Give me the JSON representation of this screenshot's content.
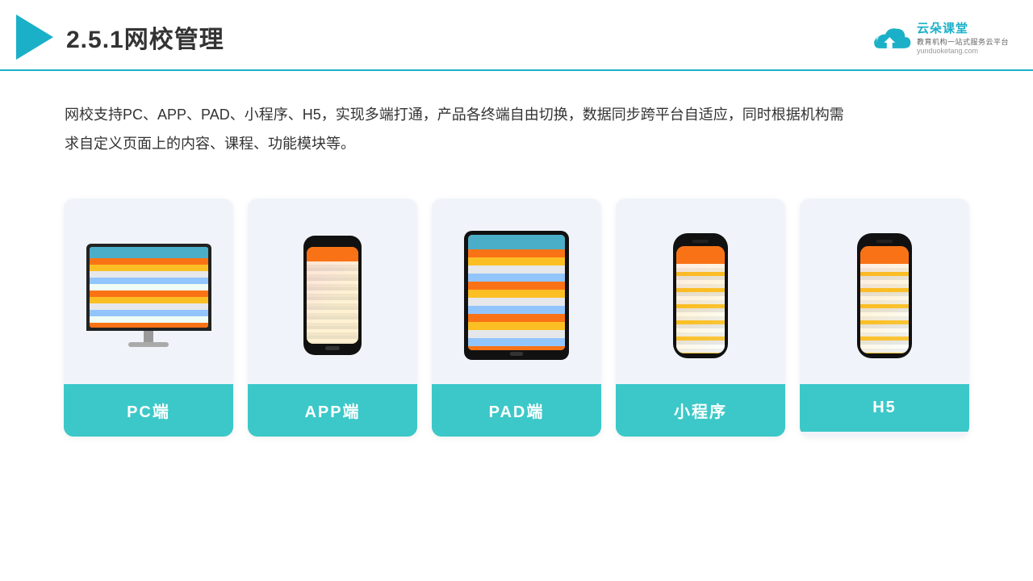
{
  "header": {
    "title": "2.5.1网校管理",
    "brand_name": "云朵课堂",
    "brand_slogan": "教育机构一站式服务云平台",
    "brand_url": "yunduoketang.com"
  },
  "description": {
    "text": "网校支持PC、APP、PAD、小程序、H5，实现多端打通，产品各终端自由切换，数据同步跨平台自适应，同时根据机构需求自定义页面上的内容、课程、功能模块等。"
  },
  "cards": [
    {
      "id": "pc",
      "label": "PC端",
      "type": "monitor"
    },
    {
      "id": "app",
      "label": "APP端",
      "type": "phone"
    },
    {
      "id": "pad",
      "label": "PAD端",
      "type": "tablet"
    },
    {
      "id": "miniapp",
      "label": "小程序",
      "type": "phone-tall"
    },
    {
      "id": "h5",
      "label": "H5",
      "type": "phone-tall"
    }
  ]
}
